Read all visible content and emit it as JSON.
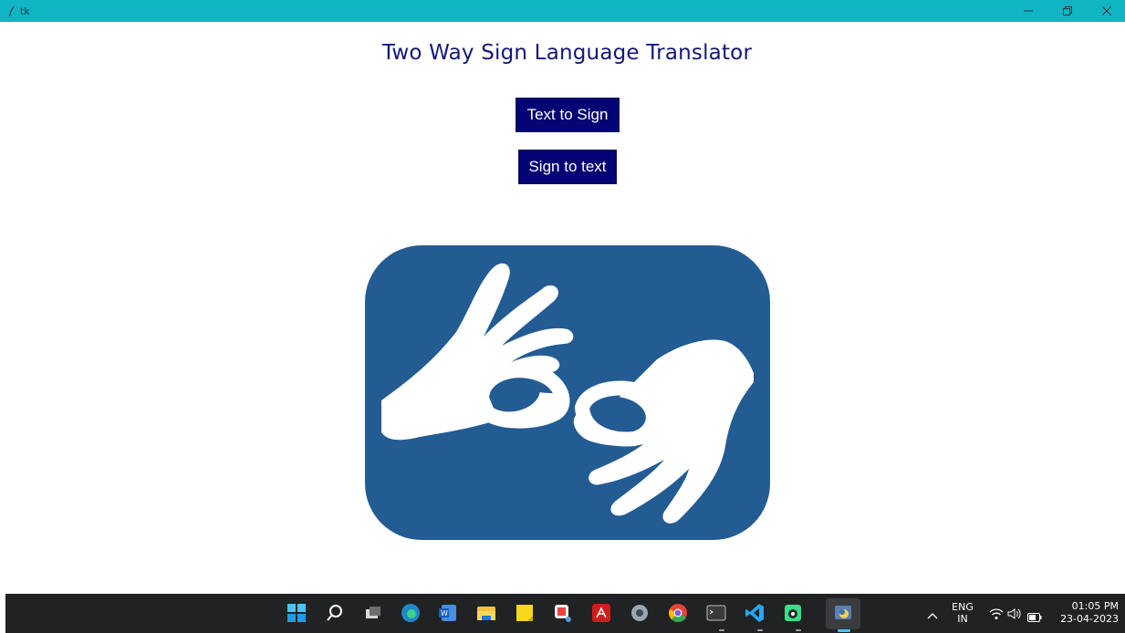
{
  "window": {
    "title": "tk",
    "controls": [
      "minimize-icon",
      "restore-icon",
      "close-icon"
    ]
  },
  "main": {
    "title": "Two Way Sign Language Translator",
    "buttons": {
      "text_to_sign": "Text to Sign",
      "sign_to_text": "Sign to text"
    },
    "logo": {
      "icon": "sign-language-hands-icon",
      "background_color": "#235b93",
      "foreground_color": "#ffffff"
    }
  },
  "taskbar": {
    "apps": [
      "windows-start-icon",
      "search-icon",
      "task-view-icon",
      "edge-icon",
      "word-icon",
      "file-explorer-icon",
      "sticky-notes-icon",
      "snipping-tool-icon",
      "acrobat-icon",
      "settings-icon",
      "chrome-icon",
      "terminal-icon",
      "vscode-icon",
      "android-studio-icon",
      "python-tk-icon"
    ],
    "tray": {
      "language_line1": "ENG",
      "language_line2": "IN",
      "time": "01:05 PM",
      "date": "23-04-2023"
    }
  },
  "colors": {
    "titlebar": "#10b5c4",
    "title_text": "#131777",
    "button_bg": "#050474",
    "taskbar": "#202224"
  }
}
